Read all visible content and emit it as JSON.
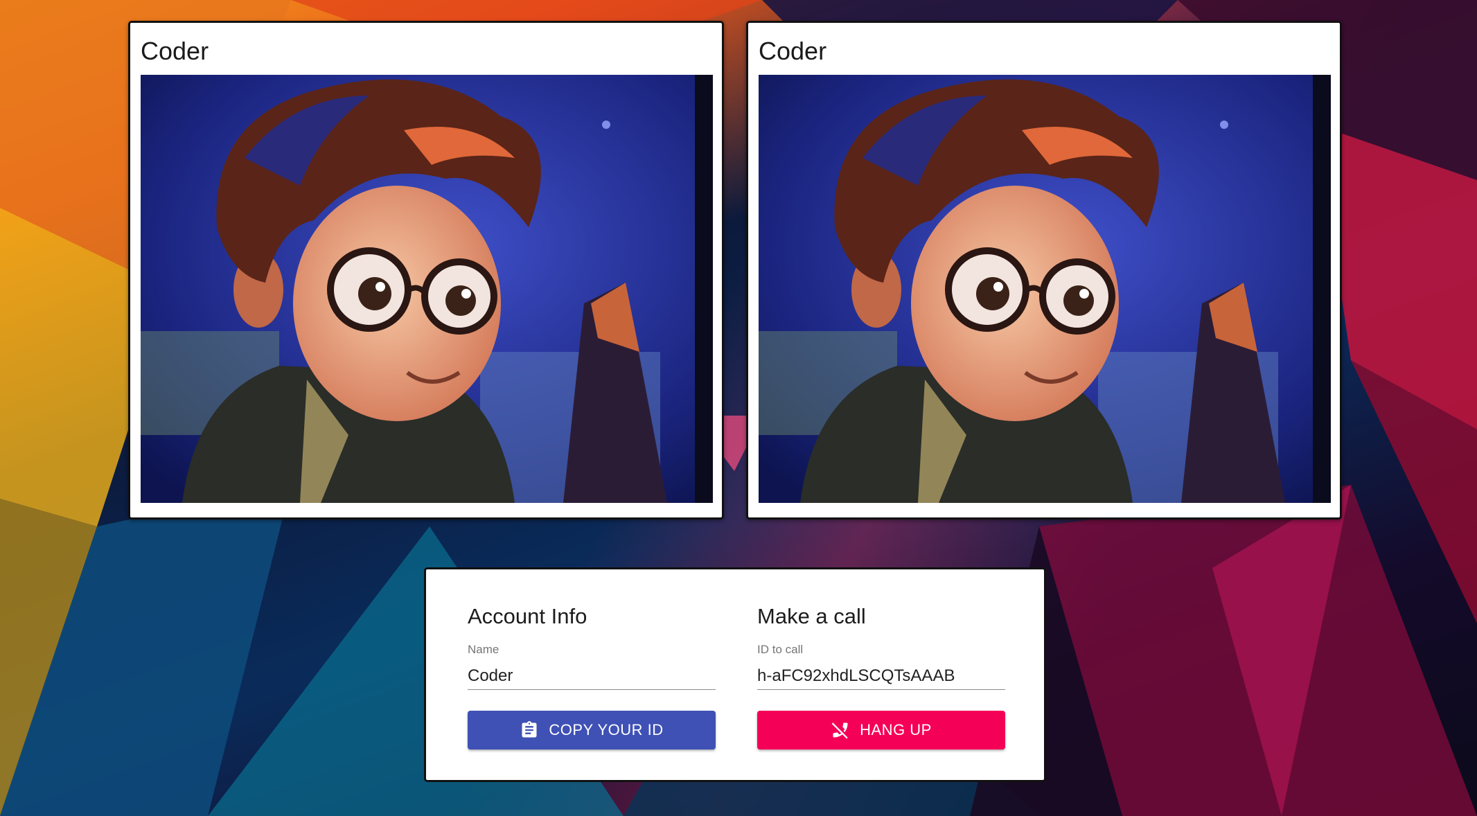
{
  "videos": {
    "left": {
      "title": "Coder"
    },
    "right": {
      "title": "Coder"
    }
  },
  "account": {
    "heading": "Account Info",
    "name_label": "Name",
    "name_value": "Coder",
    "copy_button": "COPY YOUR ID",
    "copy_icon": "clipboard-icon"
  },
  "call": {
    "heading": "Make a call",
    "id_label": "ID to call",
    "id_value": "h-aFC92xhdLSCQTsAAAB",
    "hangup_button": "HANG UP",
    "hangup_icon": "phone-disabled-icon"
  },
  "colors": {
    "primary": "#3f51b5",
    "secondary": "#f50057"
  }
}
